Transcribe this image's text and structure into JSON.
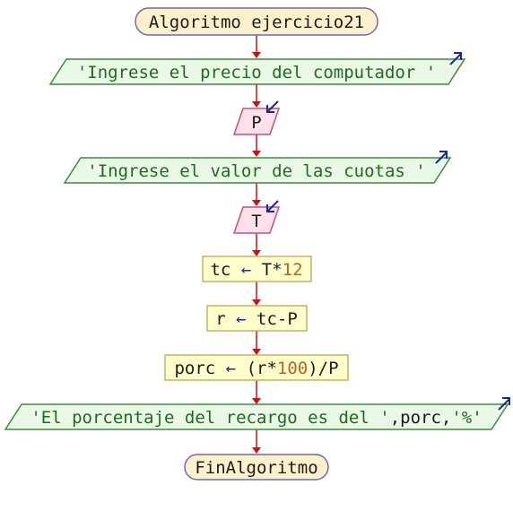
{
  "colors": {
    "start_fill": "#fff0cc",
    "start_stroke": "#6a6ab0",
    "output_fill": "#eaf8e6",
    "output_stroke": "#3c8a3c",
    "input_fill": "#fde0ea",
    "input_stroke": "#c05080",
    "process_fill": "#ffffcc",
    "process_stroke": "#c8b060",
    "connector": "#d01010",
    "io_arrow": "#1a2a8c",
    "text": "#1a1a1a",
    "string": "#1e6b1e",
    "operator": "#1a2a8c",
    "number": "#b5651d"
  },
  "start": {
    "text": "Algoritmo ejercicio21"
  },
  "end": {
    "text": "FinAlgoritmo"
  },
  "output1": {
    "text": "'Ingrese el precio del computador '"
  },
  "input1": {
    "text": "P"
  },
  "output2": {
    "text": "'Ingrese el valor de las cuotas '"
  },
  "input2": {
    "text": "T"
  },
  "process1": {
    "var": "tc",
    "op": "←",
    "expr_a": "T*",
    "expr_num": "12"
  },
  "process2": {
    "var": "r",
    "op": "←",
    "expr_a": "tc-P"
  },
  "process3": {
    "var": "porc",
    "op": "←",
    "expr_a": "(r*",
    "expr_num": "100",
    "expr_b": ")/P"
  },
  "output3": {
    "text": "'El porcentaje del recargo es del '",
    "tail": ",porc,",
    "suffix": "'%'"
  }
}
